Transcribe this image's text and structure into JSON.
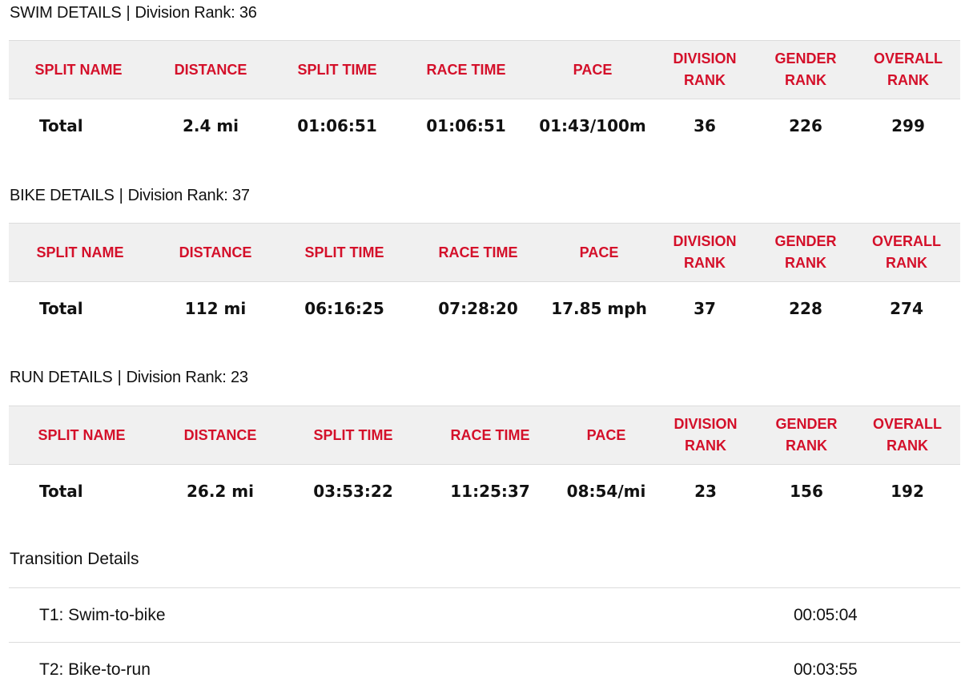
{
  "swim": {
    "title": "SWIM DETAILS",
    "rank_label": "Division Rank: 36",
    "headers": [
      "SPLIT NAME",
      "DISTANCE",
      "SPLIT TIME",
      "RACE TIME",
      "PACE"
    ],
    "headers_two_line": [
      [
        "DIVISION",
        "RANK"
      ],
      [
        "GENDER",
        "RANK"
      ],
      [
        "OVERALL",
        "RANK"
      ]
    ],
    "row": [
      "Total",
      "2.4 mi",
      "01:06:51",
      "01:06:51",
      "01:43/100m",
      "36",
      "226",
      "299"
    ]
  },
  "bike": {
    "title": "BIKE DETAILS",
    "rank_label": "Division Rank: 37",
    "headers": [
      "SPLIT NAME",
      "DISTANCE",
      "SPLIT TIME",
      "RACE TIME",
      "PACE"
    ],
    "headers_two_line": [
      [
        "DIVISION",
        "RANK"
      ],
      [
        "GENDER",
        "RANK"
      ],
      [
        "OVERALL",
        "RANK"
      ]
    ],
    "row": [
      "Total",
      "112 mi",
      "06:16:25",
      "07:28:20",
      "17.85 mph",
      "37",
      "228",
      "274"
    ]
  },
  "run": {
    "title": "RUN DETAILS",
    "rank_label": "Division Rank: 23",
    "headers": [
      "SPLIT NAME",
      "DISTANCE",
      "SPLIT TIME",
      "RACE TIME",
      "PACE"
    ],
    "headers_two_line": [
      [
        "DIVISION",
        "RANK"
      ],
      [
        "GENDER",
        "RANK"
      ],
      [
        "OVERALL",
        "RANK"
      ]
    ],
    "row": [
      "Total",
      "26.2 mi",
      "03:53:22",
      "11:25:37",
      "08:54/mi",
      "23",
      "156",
      "192"
    ]
  },
  "transition": {
    "title": "Transition Details",
    "items": [
      {
        "name": "T1: Swim-to-bike",
        "time": "00:05:04"
      },
      {
        "name": "T2: Bike-to-run",
        "time": "00:03:55"
      }
    ]
  },
  "colors": {
    "header_text": "#d4102a",
    "header_bg": "#f0f0f0",
    "divider": "#dcdcdc"
  }
}
